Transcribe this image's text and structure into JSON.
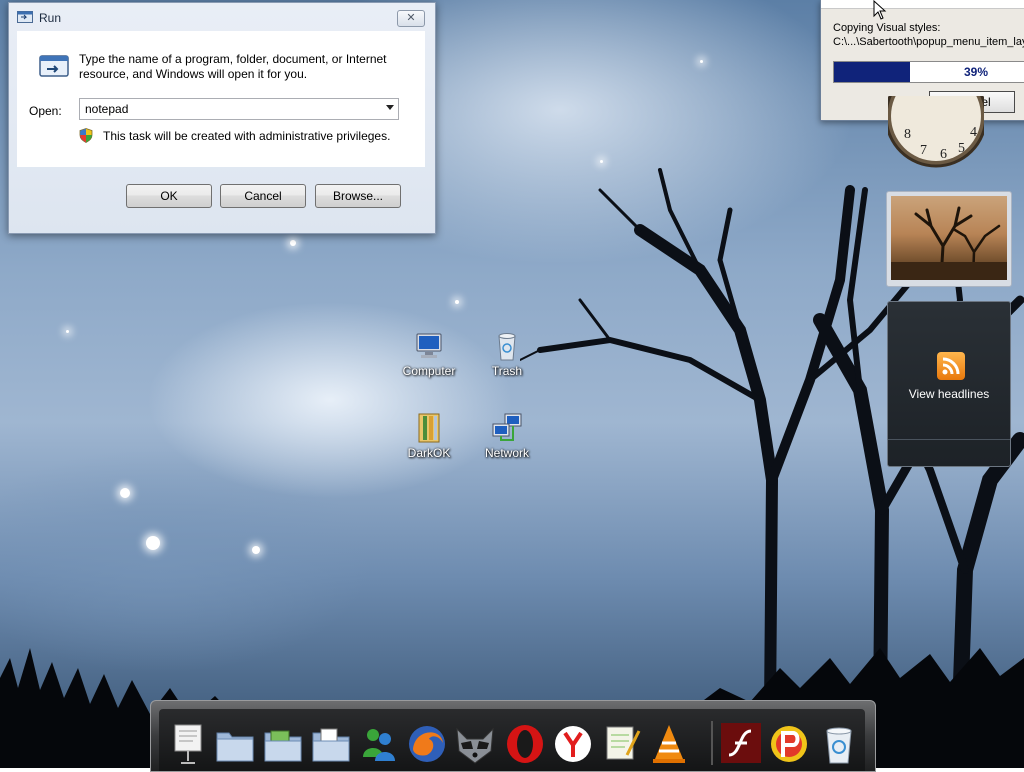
{
  "run_dialog": {
    "title": "Run",
    "description": "Type the name of a program, folder, document, or Internet resource, and Windows will open it for you.",
    "open_label": "Open:",
    "input_value": "notepad",
    "admin_note": "This task will be created with administrative privileges.",
    "ok_label": "OK",
    "cancel_label": "Cancel",
    "browse_label": "Browse..."
  },
  "copy_dialog": {
    "status": "Copying Visual styles:",
    "path": "C:\\...\\Sabertooth\\popup_menu_item_lay",
    "progress_percent": 39,
    "progress_text": "39%",
    "cancel_label": "Cancel",
    "accent": "#10237a"
  },
  "gadgets": {
    "clock_numbers": [
      "8",
      "7",
      "6",
      "5",
      "4"
    ],
    "feed_label": "View headlines"
  },
  "desktop_icons": [
    {
      "label": "Computer",
      "icon": "computer-icon"
    },
    {
      "label": "Trash",
      "icon": "trash-icon"
    },
    {
      "label": "DarkOK",
      "icon": "folder-icon"
    },
    {
      "label": "Network",
      "icon": "network-icon"
    }
  ],
  "dock_items": [
    "presentation-icon",
    "folder-icon",
    "folder-pictures-icon",
    "folder-documents-icon",
    "messenger-icon",
    "firefox-icon",
    "raccoon-icon",
    "opera-icon",
    "yandex-icon",
    "notepad-icon",
    "vlc-icon",
    "flash-icon",
    "p-app-icon",
    "recycle-bin-icon"
  ]
}
